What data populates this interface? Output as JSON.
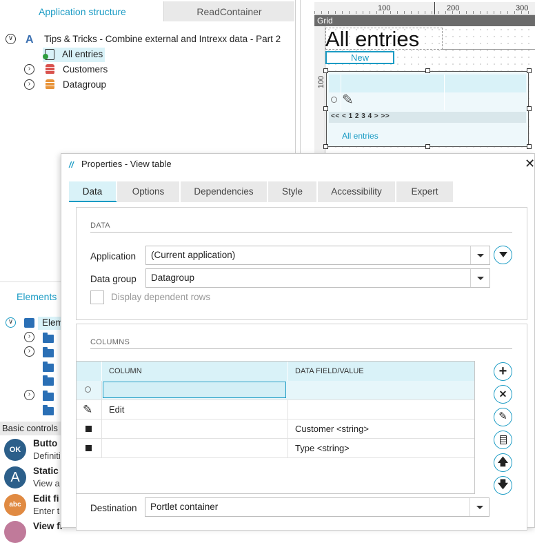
{
  "left_panel": {
    "tabs": [
      {
        "label": "Application structure"
      },
      {
        "label": "ReadContainer"
      }
    ],
    "tree": {
      "root": "Tips & Tricks - Combine external and Intrexx data - Part 2",
      "items": [
        {
          "label": "All entries"
        },
        {
          "label": "Customers"
        },
        {
          "label": "Datagroup"
        }
      ]
    },
    "elements_tab": "Elements",
    "elements_root": "Elem",
    "basic_controls": "Basic controls",
    "controls": [
      {
        "title": "Butto",
        "sub": "Definiti",
        "icon": "ok-button-icon",
        "icon_text": "OK",
        "color": "#2c5f8a"
      },
      {
        "title": "Static",
        "sub": "View a",
        "icon": "static-text-icon",
        "icon_text": "A",
        "color": "#2c5f8a"
      },
      {
        "title": "Edit fi",
        "sub": "Enter t",
        "icon": "edit-field-icon",
        "icon_text": "abc",
        "color": "#e08a42"
      },
      {
        "title": "View fi",
        "sub": "",
        "icon": "view-field-icon",
        "icon_text": "",
        "color": "#c07a9a"
      }
    ]
  },
  "canvas": {
    "ruler_labels": [
      "100",
      "200",
      "300"
    ],
    "ruler_left_label": "100",
    "grid_label": "Grid",
    "page_title": "All entries",
    "new_button": "New",
    "pager": "<< < 1 2 3 4 > >>",
    "table_caption": "All entries"
  },
  "dialog": {
    "title": "Properties - View table",
    "tabs": [
      {
        "label": "Data"
      },
      {
        "label": "Options"
      },
      {
        "label": "Dependencies"
      },
      {
        "label": "Style"
      },
      {
        "label": "Accessibility"
      },
      {
        "label": "Expert"
      }
    ],
    "data_section": {
      "title": "DATA",
      "application_label": "Application",
      "application_value": "(Current application)",
      "datagroup_label": "Data group",
      "datagroup_value": "Datagroup",
      "dependent_rows_label": "Display dependent rows"
    },
    "columns_section": {
      "title": "COLUMNS",
      "headers": [
        "COLUMN",
        "DATA FIELD/VALUE"
      ],
      "rows": [
        {
          "column": "",
          "field": ""
        },
        {
          "column": "Edit",
          "field": ""
        },
        {
          "column": "",
          "field": "Customer <string>"
        },
        {
          "column": "",
          "field": "Type <string>"
        }
      ]
    },
    "destination_label": "Destination",
    "destination_value": "Portlet container"
  },
  "colors": {
    "accent": "#1a9bc4",
    "tab_active_bg": "#d9f2f8"
  }
}
